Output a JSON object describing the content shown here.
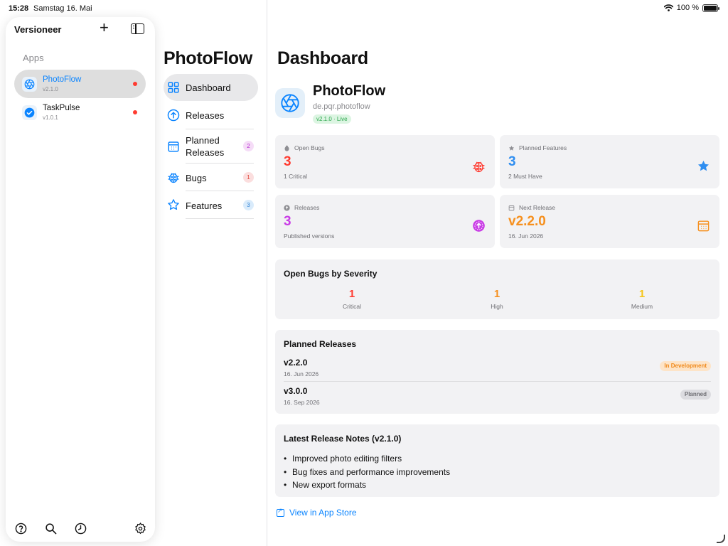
{
  "status_bar": {
    "time": "15:28",
    "date": "Samstag 16. Mai",
    "battery": "100 %"
  },
  "sidebar": {
    "title": "Versioneer",
    "section": "Apps",
    "apps": [
      {
        "name": "PhotoFlow",
        "version": "v2.1.0",
        "selected": true,
        "icon": "aperture-icon"
      },
      {
        "name": "TaskPulse",
        "version": "v1.0.1",
        "selected": false,
        "icon": "checkmark-circle-icon"
      }
    ],
    "bottom_icons": [
      "help-icon",
      "search-icon",
      "history-icon",
      "settings-icon"
    ]
  },
  "nav": {
    "title": "PhotoFlow",
    "items": [
      {
        "label": "Dashboard",
        "icon": "grid-icon",
        "badge": ""
      },
      {
        "label": "Releases",
        "icon": "arrow-up-circle-icon",
        "badge": ""
      },
      {
        "label": "Planned\nReleases",
        "icon": "calendar-icon",
        "badge": "2"
      },
      {
        "label": "Bugs",
        "icon": "ladybug-icon",
        "badge": "1"
      },
      {
        "label": "Features",
        "icon": "star-icon",
        "badge": "3"
      }
    ]
  },
  "dashboard": {
    "title": "Dashboard",
    "app": {
      "name": "PhotoFlow",
      "bundle": "de.pqr.photoflow",
      "tag": "v2.1.0 · Live"
    },
    "stats": {
      "open_bugs": {
        "label": "Open Bugs",
        "value": "3",
        "sub": "1 Critical",
        "color": "#ff3b30"
      },
      "planned_features": {
        "label": "Planned Features",
        "value": "3",
        "sub": "2 Must Have",
        "color": "#2f8ef0"
      },
      "releases": {
        "label": "Releases",
        "value": "3",
        "sub": "Published versions",
        "color": "#c93ce6"
      },
      "next_release": {
        "label": "Next Release",
        "value": "v2.2.0",
        "sub": "16. Jun 2026",
        "color": "#f6901e"
      }
    },
    "severity": {
      "title": "Open Bugs by Severity",
      "items": [
        {
          "value": "1",
          "label": "Critical",
          "color": "#ff3b30"
        },
        {
          "value": "1",
          "label": "High",
          "color": "#f6901e"
        },
        {
          "value": "1",
          "label": "Medium",
          "color": "#f5c518"
        }
      ]
    },
    "planned": {
      "title": "Planned Releases",
      "items": [
        {
          "version": "v2.2.0",
          "date": "16. Jun 2026",
          "status": "In Development"
        },
        {
          "version": "v3.0.0",
          "date": "16. Sep 2026",
          "status": "Planned"
        }
      ]
    },
    "notes": {
      "title": "Latest Release Notes (v2.1.0)",
      "items": [
        "Improved photo editing filters",
        "Bug fixes and performance improvements",
        "New export formats"
      ]
    },
    "store_link": "View in App Store"
  }
}
